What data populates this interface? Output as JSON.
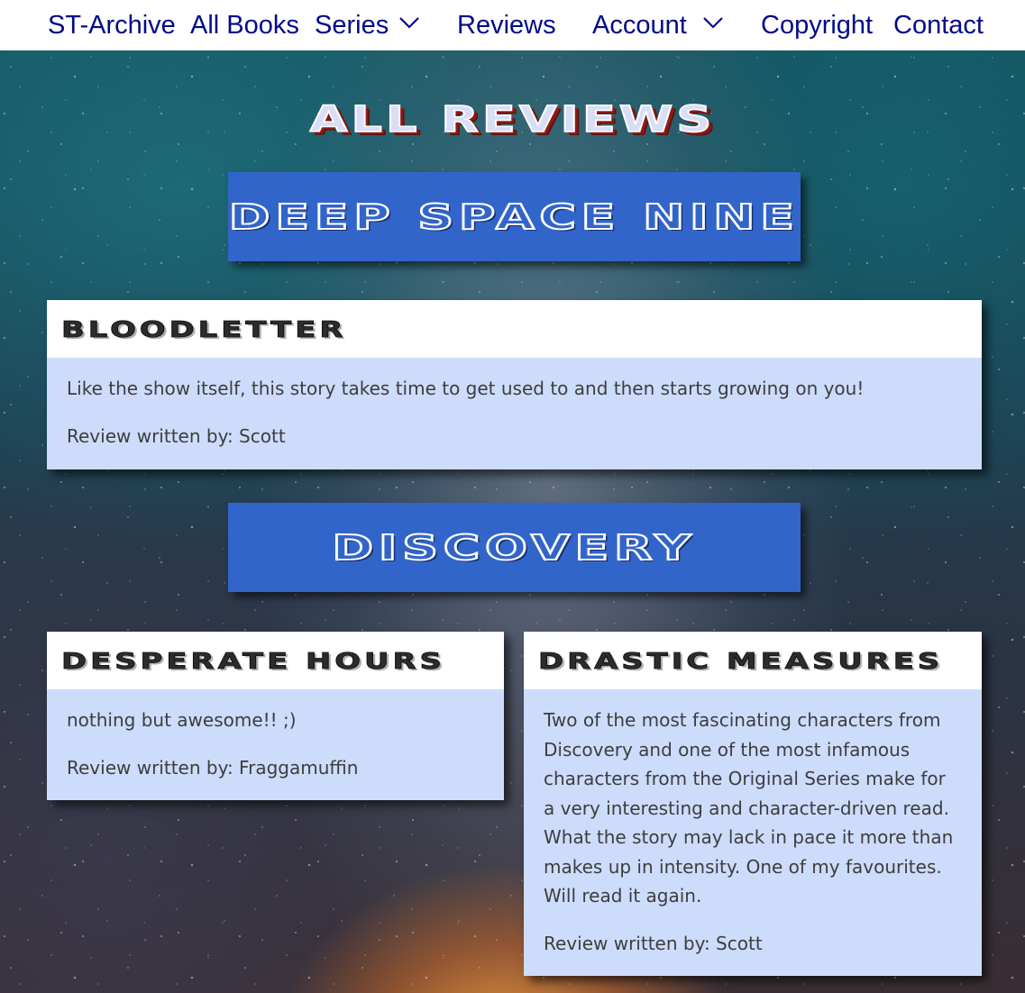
{
  "nav": {
    "brand": "ST-Archive",
    "all_books": "All Books",
    "series": "Series",
    "reviews": "Reviews",
    "account": "Account",
    "copyright": "Copyright",
    "contact": "Contact"
  },
  "page_title": "ALL REVIEWS",
  "sections": [
    {
      "series": "DEEP SPACE NINE",
      "reviews": [
        {
          "book": "BLOODLETTER",
          "text": "Like the show itself, this story takes time to get used to and then starts growing on you!",
          "author_line": "Review written by: Scott"
        }
      ]
    },
    {
      "series": "DISCOVERY",
      "reviews": [
        {
          "book": "DESPERATE HOURS",
          "text": "nothing but awesome!! ;)",
          "author_line": "Review written by: Fraggamuffin"
        },
        {
          "book": "DRASTIC MEASURES",
          "text": "Two of the most fascinating characters from Discovery and one of the most infamous characters from the Original Series make for a very interesting and character-driven read. What the story may lack in pace it more than makes up in intensity. One of my favourites. Will read it again.",
          "author_line": "Review written by: Scott"
        }
      ]
    }
  ],
  "colors": {
    "nav_text": "#000a8a",
    "banner": "#3265c9",
    "card_body": "#cddcfb",
    "title_shadow": "#8a1a14"
  },
  "icons": {
    "series_dropdown": "chevron-down-icon",
    "account_dropdown": "chevron-down-icon"
  }
}
